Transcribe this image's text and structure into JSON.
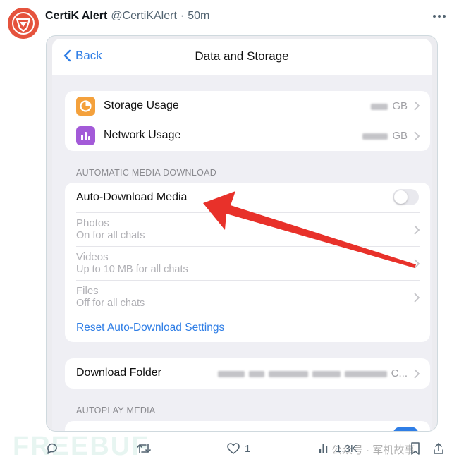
{
  "tweet": {
    "author": "CertiK Alert",
    "handle": "@CertiKAlert",
    "separator": "·",
    "time": "50m"
  },
  "screen": {
    "back_label": "Back",
    "title": "Data and Storage",
    "usage_rows": [
      {
        "label": "Storage Usage",
        "value": "GB",
        "icon": "pie-chart-icon",
        "color": "#f4a13c"
      },
      {
        "label": "Network Usage",
        "value": "GB",
        "icon": "bar-chart-icon",
        "color": "#a35ad8"
      }
    ],
    "auto_section_header": "AUTOMATIC MEDIA DOWNLOAD",
    "auto_download": {
      "label": "Auto-Download Media",
      "enabled": false
    },
    "media_types": [
      {
        "title": "Photos",
        "subtitle": "On for all chats"
      },
      {
        "title": "Videos",
        "subtitle": "Up to 10 MB for all chats"
      },
      {
        "title": "Files",
        "subtitle": "Off for all chats"
      }
    ],
    "reset_label": "Reset Auto-Download Settings",
    "download_folder": {
      "label": "Download Folder",
      "value": "C..."
    },
    "autoplay_section_header": "AUTOPLAY MEDIA"
  },
  "actions": {
    "likes": "1",
    "views": "1.3K"
  },
  "watermark": {
    "brand": "FREEBUF",
    "cn_text": "公众号 · 军机故事"
  },
  "colors": {
    "ios_blue": "#2f7ee6",
    "annotation_red": "#e8312a",
    "avatar": "#e5533d"
  }
}
